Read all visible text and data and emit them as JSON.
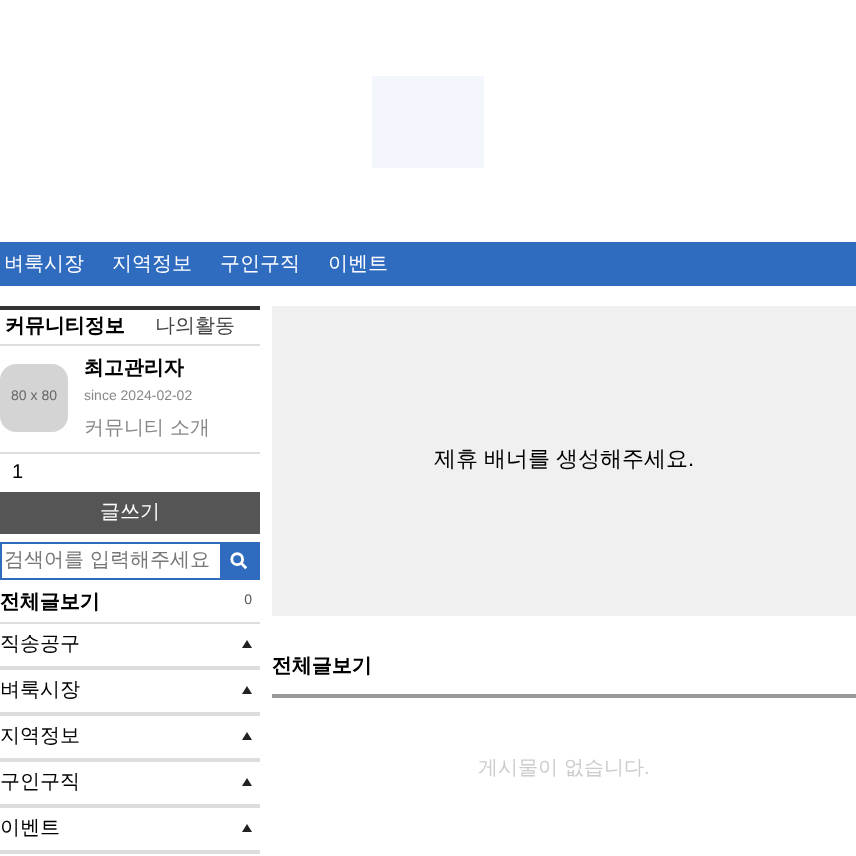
{
  "nav": {
    "items": [
      "벼룩시장",
      "지역정보",
      "구인구직",
      "이벤트"
    ]
  },
  "sidebar": {
    "tabs": [
      {
        "label": "커뮤니티정보",
        "selected": true
      },
      {
        "label": "나의활동",
        "selected": false
      }
    ],
    "profile": {
      "avatar": "80 x 80",
      "name": "최고관리자",
      "since": "since 2024-02-02",
      "intro": "커뮤니티 소개"
    },
    "member_count": "1",
    "write_button": "글쓰기",
    "search": {
      "placeholder": "검색어를 입력해주세요"
    },
    "all_posts": {
      "label": "전체글보기",
      "count": "0"
    },
    "categories": [
      "직송공구",
      "벼룩시장",
      "지역정보",
      "구인구직",
      "이벤트"
    ]
  },
  "banner": {
    "text": "제휴 배너를 생성해주세요."
  },
  "board": {
    "title": "전체글보기",
    "empty": "게시물이 없습니다."
  }
}
